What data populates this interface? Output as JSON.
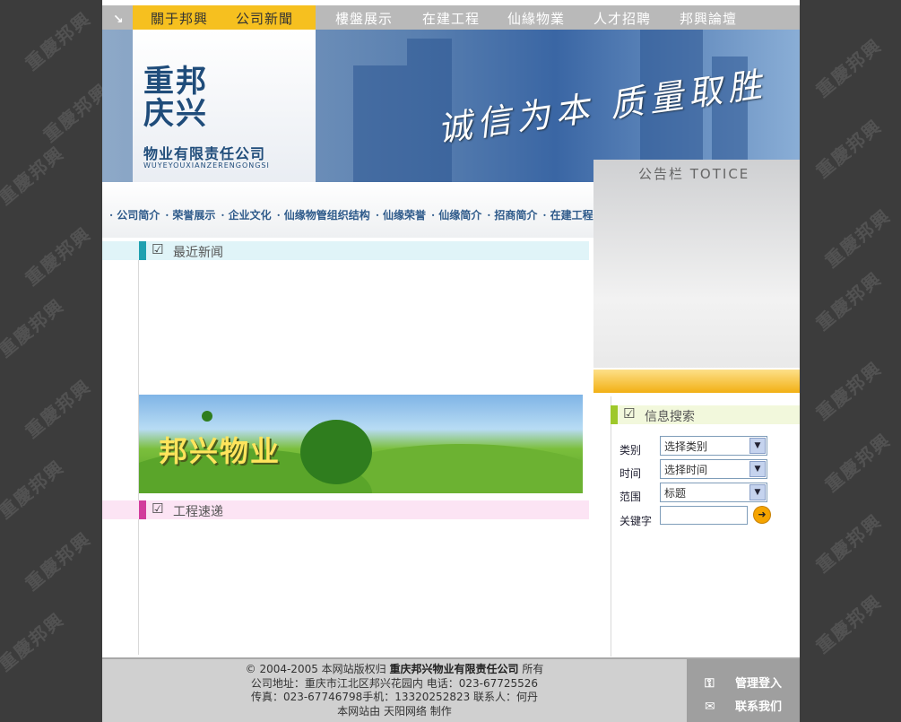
{
  "watermark": "重慶邦興",
  "top_nav": {
    "active_items": [
      "關于邦興",
      "公司新聞"
    ],
    "items": [
      "樓盤展示",
      "在建工程",
      "仙緣物業",
      "人才招聘",
      "邦興論壇"
    ]
  },
  "logo": {
    "big_line1": "重邦",
    "big_line2": "庆兴",
    "company": "物业有限责任公司",
    "pinyin": "WUYEYOUXIANZERENGONGSI"
  },
  "banner": {
    "slogan": "诚信为本 质量取胜"
  },
  "notice_board": {
    "title": "公告栏 TOTICE"
  },
  "sub_nav": [
    "公司简介",
    "荣誉展示",
    "企业文化",
    "仙缘物管组织结构",
    "仙缘荣誉",
    "仙缘简介",
    "招商简介",
    "在建工程"
  ],
  "sections": {
    "latest_news": "最近新闻",
    "project_news": "工程速递",
    "info_search": "信息搜索"
  },
  "green_banner": {
    "text": "邦兴物业"
  },
  "search": {
    "category_label": "类别",
    "category_value": "选择类别",
    "time_label": "时间",
    "time_value": "选择时间",
    "scope_label": "范围",
    "scope_value": "标题",
    "keyword_label": "关键字",
    "keyword_value": ""
  },
  "footer": {
    "line1_prefix": "© 2004-2005 本网站版权归",
    "line1_company": "重庆邦兴物业有限责任公司",
    "line1_suffix": "所有",
    "line2": "公司地址：重庆市江北区邦兴花园内 电话：023-67725526",
    "line3": "传真：023-67746798手机：13320252823 联系人：何丹",
    "line4": "本网站由 天阳网络 制作",
    "admin_login": "管理登入",
    "contact_us": "联系我们"
  },
  "colors": {
    "nav_active_bg": "#f6c01f",
    "news_tab": "#1fa0b0",
    "project_tab": "#d23c9c",
    "search_tab": "#9ec82a"
  }
}
